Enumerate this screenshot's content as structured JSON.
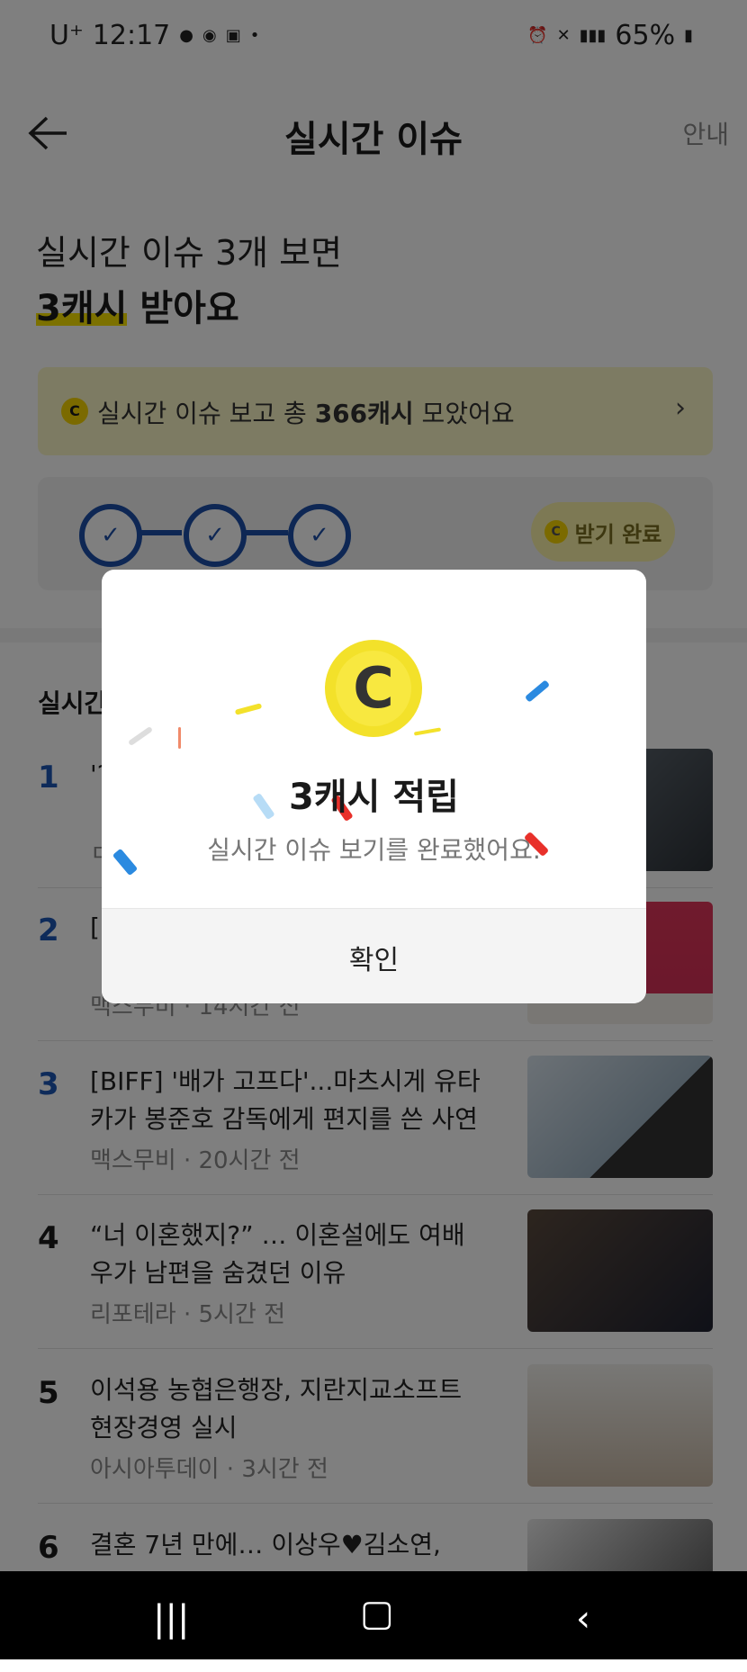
{
  "status": {
    "carrier": "U⁺",
    "time": "12:17",
    "battery": "65%"
  },
  "header": {
    "title": "실시간 이슈",
    "guide": "안내"
  },
  "intro": {
    "line1": "실시간 이슈 3개 보면",
    "bold": "3캐시",
    "line2_rest": " 받아요"
  },
  "banner": {
    "coin": "C",
    "text_pre": "실시간 이슈 보고 총 ",
    "amount": "366캐시",
    "text_post": " 모았어요",
    "chevron": "›"
  },
  "progress": {
    "done_coin": "C",
    "done_label": "받기 완료"
  },
  "section_title": "실시간",
  "items": [
    {
      "rank": "1",
      "headline": "'?",
      "meta": "ㅁ"
    },
    {
      "rank": "2",
      "headline": "[",
      "meta": "맥스무비 · 14시간 전"
    },
    {
      "rank": "3",
      "headline": "[BIFF] '배가 고프다'...마츠시게 유타카가 봉준호 감독에게 편지를 쓴 사연",
      "meta": "맥스무비 · 20시간 전"
    },
    {
      "rank": "4",
      "headline": "“너 이혼했지?” … 이혼설에도 여배우가 남편을 숨겼던 이유",
      "meta": "리포테라 · 5시간 전"
    },
    {
      "rank": "5",
      "headline": "이석용 농협은행장, 지란지교소프트 현장경영 실시",
      "meta": "아시아투데이 · 3시간 전"
    },
    {
      "rank": "6",
      "headline": "결혼 7년 만에… 이상우♥김소연,",
      "meta": ""
    }
  ],
  "modal": {
    "coin": "C",
    "title": "3캐시 적립",
    "subtitle": "실시간 이슈 보기를 완료했어요.",
    "confirm": "확인"
  },
  "colors": {
    "accent_blue": "#1c4fa8",
    "coin_yellow": "#f3e12a",
    "highlight": "#f8e300"
  }
}
